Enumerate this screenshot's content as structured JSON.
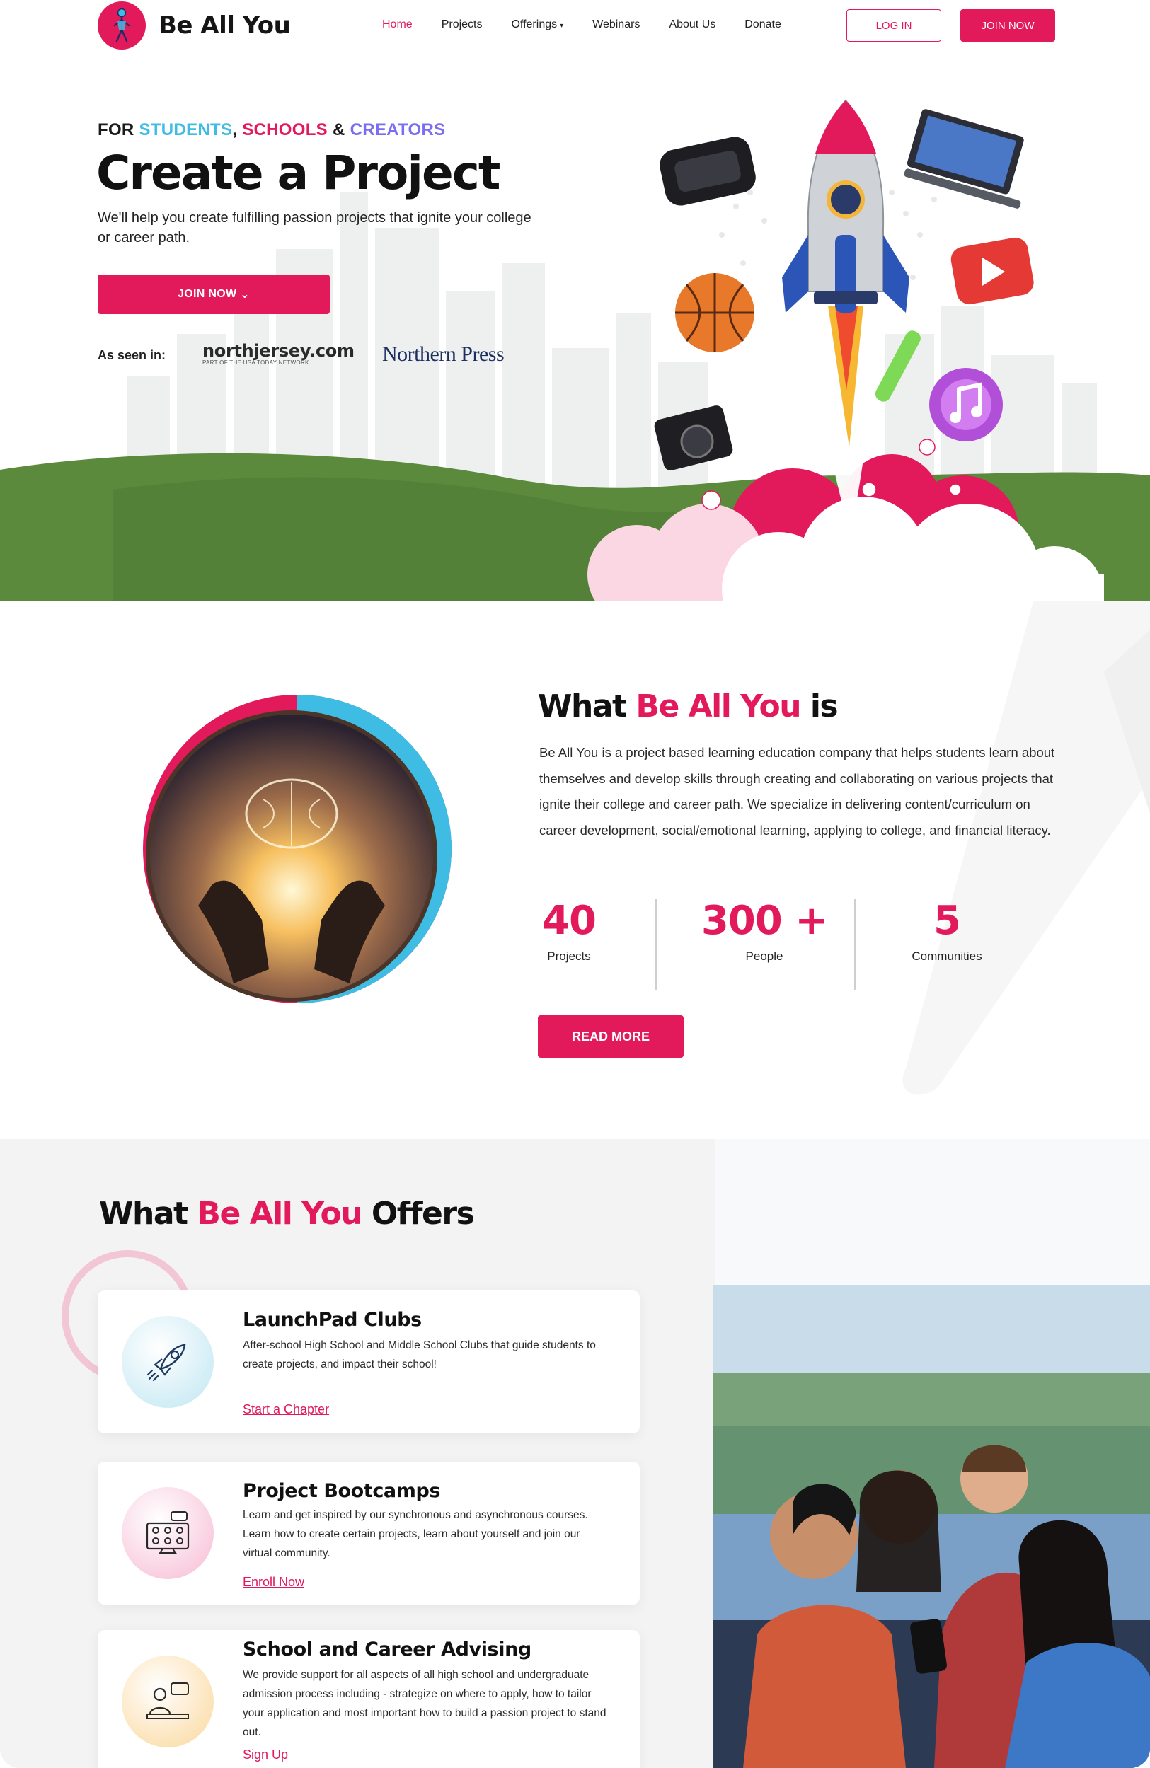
{
  "brand": {
    "name": "Be All You",
    "pink": "#e2195b",
    "blue": "#3ebce4",
    "purple": "#7b6cf0"
  },
  "nav": {
    "items": [
      {
        "label": "Home",
        "active": true
      },
      {
        "label": "Projects"
      },
      {
        "label": "Offerings",
        "caret": "▾"
      },
      {
        "label": "Webinars"
      },
      {
        "label": "About Us"
      },
      {
        "label": "Donate"
      }
    ],
    "login": "LOG IN",
    "join": "JOIN NOW"
  },
  "hero": {
    "tag_for": "FOR ",
    "tag_students": "STUDENTS",
    "tag_comma": ", ",
    "tag_schools": "SCHOOLS",
    "tag_amp": " & ",
    "tag_creators": "CREATORS",
    "title": "Create a Project",
    "subtitle": "We'll help you create fulfilling passion projects that ignite your college or career path.",
    "cta": "JOIN NOW",
    "cta_caret": "⌄",
    "seen_in": "As seen in:",
    "press": [
      {
        "name": "northjersey.com",
        "tagline": "PART OF THE USA TODAY NETWORK"
      },
      {
        "name": "Northern Press",
        "accent": "Valley"
      }
    ]
  },
  "about": {
    "title_a": "What ",
    "title_b": "Be All You",
    "title_c": " is",
    "text": "Be All You is a project based learning education company that helps students learn about themselves and develop skills through creating and collaborating on various projects that ignite their college and career path. We specialize  in delivering content/curriculum on career development, social/emotional learning, applying to college, and financial literacy.",
    "stats": [
      {
        "value": "40",
        "label": "Projects"
      },
      {
        "value": "300 +",
        "label": "People"
      },
      {
        "value": "5",
        "label": "Communities"
      }
    ],
    "cta": "READ MORE"
  },
  "offers": {
    "title_a": "What ",
    "title_b": "Be All You",
    "title_c": " Offers",
    "cards": [
      {
        "title": "LaunchPad Clubs",
        "desc": "After-school High School and Middle School Clubs that guide students to create projects, and impact their school!",
        "link": "Start a Chapter",
        "icon": "rocket-icon"
      },
      {
        "title": "Project Bootcamps",
        "desc": "Learn and get inspired by our synchronous and asynchronous courses. Learn how to create certain projects, learn about yourself and join our virtual community.",
        "link": "Enroll Now",
        "icon": "video-conference-icon"
      },
      {
        "title": "School and Career Advising",
        "desc": "We provide support for all aspects of all high school and undergraduate admission process including - strategize on where to apply, how to tailor your application and most important how to build a passion project to stand out.",
        "link": "Sign Up",
        "icon": "advisor-icon"
      }
    ]
  }
}
